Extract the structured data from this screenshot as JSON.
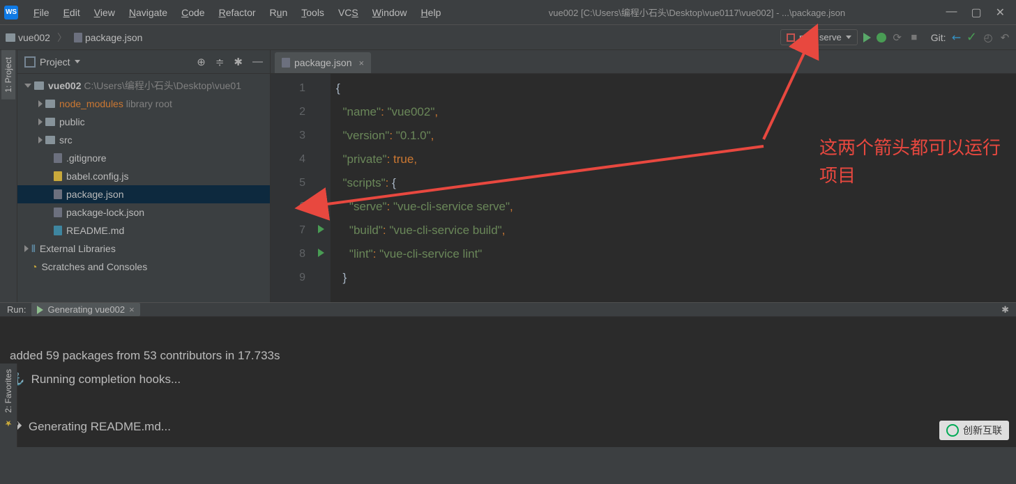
{
  "menu": {
    "items": [
      "File",
      "Edit",
      "View",
      "Navigate",
      "Code",
      "Refactor",
      "Run",
      "Tools",
      "VCS",
      "Window",
      "Help"
    ]
  },
  "window_title": "vue002 [C:\\Users\\编程小石头\\Desktop\\vue0117\\vue002] - ...\\package.json",
  "breadcrumb": {
    "project": "vue002",
    "file": "package.json"
  },
  "run_config": {
    "label": "npm serve"
  },
  "git_label": "Git:",
  "project_panel": {
    "title": "Project",
    "root": {
      "name": "vue002",
      "path": "C:\\Users\\编程小石头\\Desktop\\vue01"
    },
    "node_modules": {
      "name": "node_modules",
      "suffix": "library root"
    },
    "folders": [
      "public",
      "src"
    ],
    "files": [
      ".gitignore",
      "babel.config.js",
      "package.json",
      "package-lock.json",
      "README.md"
    ],
    "external": "External Libraries",
    "scratches": "Scratches and Consoles"
  },
  "editor": {
    "tab": "package.json",
    "lines": [
      "1",
      "2",
      "3",
      "4",
      "5",
      "6",
      "7",
      "8",
      "9"
    ],
    "code": {
      "name_key": "\"name\"",
      "name_val": "\"vue002\"",
      "version_key": "\"version\"",
      "version_val": "\"0.1.0\"",
      "private_key": "\"private\"",
      "private_val": "true",
      "scripts_key": "\"scripts\"",
      "serve_key": "\"serve\"",
      "serve_val": "\"vue-cli-service serve\"",
      "build_key": "\"build\"",
      "build_val": "\"vue-cli-service build\"",
      "lint_key": "\"lint\"",
      "lint_val": "\"vue-cli-service lint\""
    }
  },
  "annotation": {
    "line1": "这两个箭头都可以运行",
    "line2": "项目"
  },
  "run_panel": {
    "label": "Run:",
    "tab": "Generating vue002",
    "lines": [
      "added 59 packages from 53 contributors in 17.733s",
      "⚓  Running completion hooks...",
      "",
      "�  Generating README.md...",
      ""
    ]
  },
  "sidetabs": {
    "project": "1: Project",
    "favorites": "2: Favorites"
  },
  "watermark": "创新互联"
}
